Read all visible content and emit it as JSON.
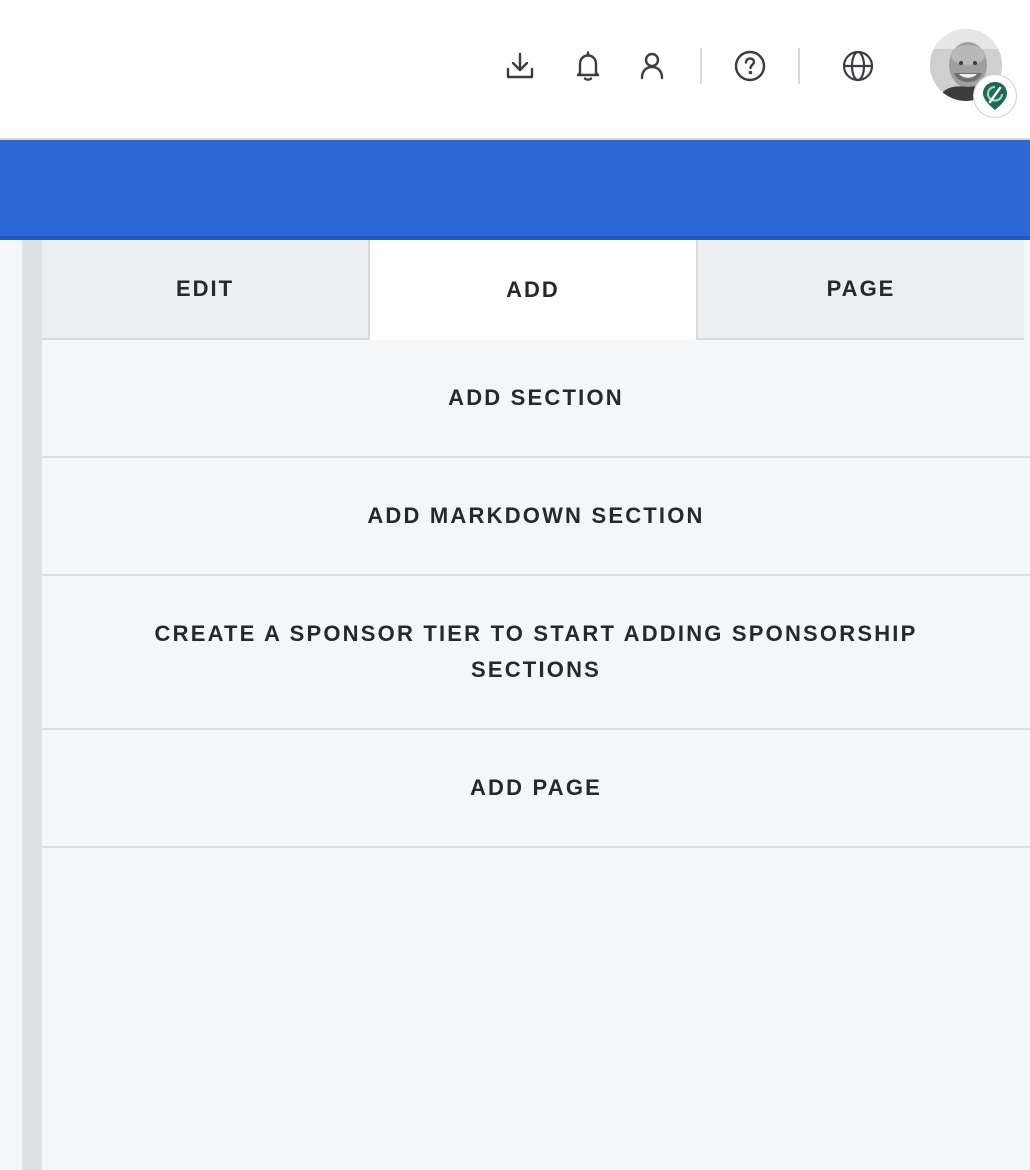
{
  "header": {
    "icons": [
      "download-icon",
      "bell-icon",
      "user-icon",
      "help-icon",
      "globe-icon"
    ],
    "avatar_badge_icon": "map-pin-icon"
  },
  "colors": {
    "brand_blue": "#2d69d4",
    "tab_inactive": "#edeef0",
    "tab_active": "#ffffff",
    "panel_bg": "#f5f6f8",
    "text": "#25282d"
  },
  "tabs": [
    {
      "label": "EDIT",
      "active": false
    },
    {
      "label": "ADD",
      "active": true
    },
    {
      "label": "PAGE",
      "active": false
    }
  ],
  "menu": {
    "items": [
      {
        "label": "ADD SECTION"
      },
      {
        "label": "ADD MARKDOWN SECTION"
      },
      {
        "label": "CREATE A SPONSOR TIER TO START ADDING SPONSORSHIP SECTIONS"
      },
      {
        "label": "ADD PAGE"
      }
    ]
  }
}
